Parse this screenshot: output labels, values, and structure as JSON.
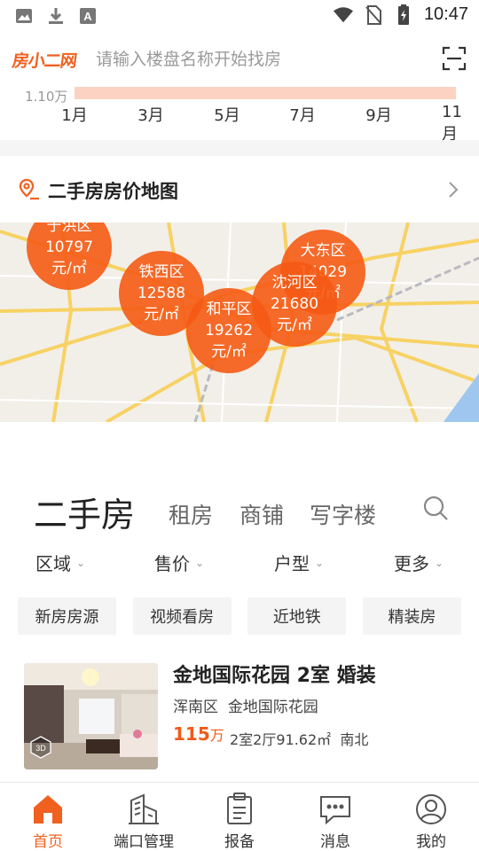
{
  "status_bar": {
    "time": "10:47",
    "left_icons": [
      "image-icon",
      "download-icon",
      "text-icon"
    ],
    "right_icons": [
      "wifi-icon",
      "no-sim-icon",
      "battery-charging-icon"
    ]
  },
  "header": {
    "logo_text": "房小二网",
    "search_placeholder": "请输入楼盘名称开始找房",
    "scan_icon": "scan-icon"
  },
  "price_trend": {
    "y_tick": "1.10万",
    "x_ticks": [
      "1月",
      "3月",
      "5月",
      "7月",
      "9月",
      "11月"
    ],
    "colors": {
      "bar": "#fcd2c2"
    }
  },
  "map_section": {
    "title": "二手房房价地图",
    "districts": [
      {
        "name": "于洪区",
        "price": "10797",
        "unit": "元/㎡"
      },
      {
        "name": "铁西区",
        "price": "12588",
        "unit": "元/㎡"
      },
      {
        "name": "和平区",
        "price": "19262",
        "unit": "元/㎡"
      },
      {
        "name": "沈河区",
        "price": "21680",
        "unit": "元/㎡"
      },
      {
        "name": "大东区",
        "price": "14029",
        "unit": "元/㎡"
      }
    ],
    "colors": {
      "bubble": "#f55a14",
      "map_bg": "#f2efe9",
      "road": "#f7d264"
    }
  },
  "tabs": {
    "items": [
      "二手房",
      "租房",
      "商铺",
      "写字楼"
    ],
    "active": "二手房"
  },
  "filters": [
    "区域",
    "售价",
    "户型",
    "更多"
  ],
  "chips": [
    "新房房源",
    "视频看房",
    "近地铁",
    "精装房"
  ],
  "listing": {
    "title": "金地国际花园 2室 婚装",
    "district": "浑南区",
    "community": "金地国际花园",
    "price": "115",
    "price_unit": "万",
    "layout": "2室2厅91.62㎡",
    "orientation": "南北",
    "badge": "3D"
  },
  "bottom_nav": {
    "items": [
      {
        "label": "首页",
        "icon": "home-icon"
      },
      {
        "label": "端口管理",
        "icon": "buildings-icon"
      },
      {
        "label": "报备",
        "icon": "report-icon"
      },
      {
        "label": "消息",
        "icon": "message-icon"
      },
      {
        "label": "我的",
        "icon": "profile-icon"
      }
    ],
    "active": "首页",
    "colors": {
      "active": "#f0601f"
    }
  }
}
